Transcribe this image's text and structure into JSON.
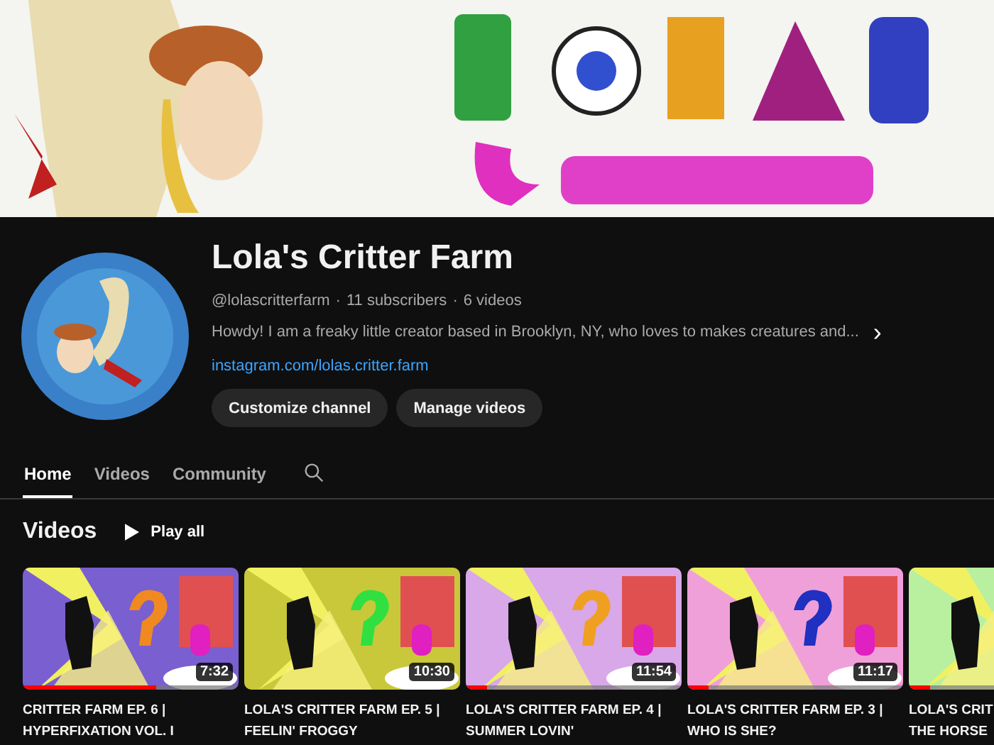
{
  "banner": {
    "kind": "picture"
  },
  "channel": {
    "name": "Lola's Critter Farm",
    "handle": "@lolascritterfarm",
    "separator_1": "·",
    "subscribers": "11 subscribers",
    "separator_2": "·",
    "videos": "6 videos",
    "description": "Howdy! I am a freaky little creator based in Brooklyn, NY, who loves to makes creatures and...",
    "more": "›",
    "link": "instagram.com/lolas.critter.farm"
  },
  "buttons": [
    "Customize channel",
    "Manage videos"
  ],
  "tabs": [
    {
      "label": "Home",
      "selected": true
    },
    {
      "label": "Videos",
      "selected": false
    },
    {
      "label": "Community",
      "selected": false
    }
  ],
  "section": {
    "title": "Videos",
    "play_all": "Play all"
  },
  "videos": [
    {
      "title_lines": [
        "CRITTER FARM EP. 6 |",
        "HYPERFIXATION VOL. I"
      ],
      "duration": "7:32",
      "level": 0.62
    },
    {
      "title_lines": [
        "LOLA'S CRITTER FARM EP. 5 |",
        "FEELIN' FROGGY"
      ],
      "duration": "10:30"
    },
    {
      "title_lines": [
        "LOLA'S CRITTER FARM EP. 4 |",
        "SUMMER LOVIN'"
      ],
      "duration": "11:54",
      "level": 0.1
    },
    {
      "title_lines": [
        "LOLA'S CRITTER FARM EP. 3 |",
        "WHO IS SHE?"
      ],
      "duration": "11:17",
      "level": 0.1
    },
    {
      "title_lines": [
        "LOLA'S CRIT",
        "THE HORSE"
      ],
      "level": 0.1
    }
  ]
}
